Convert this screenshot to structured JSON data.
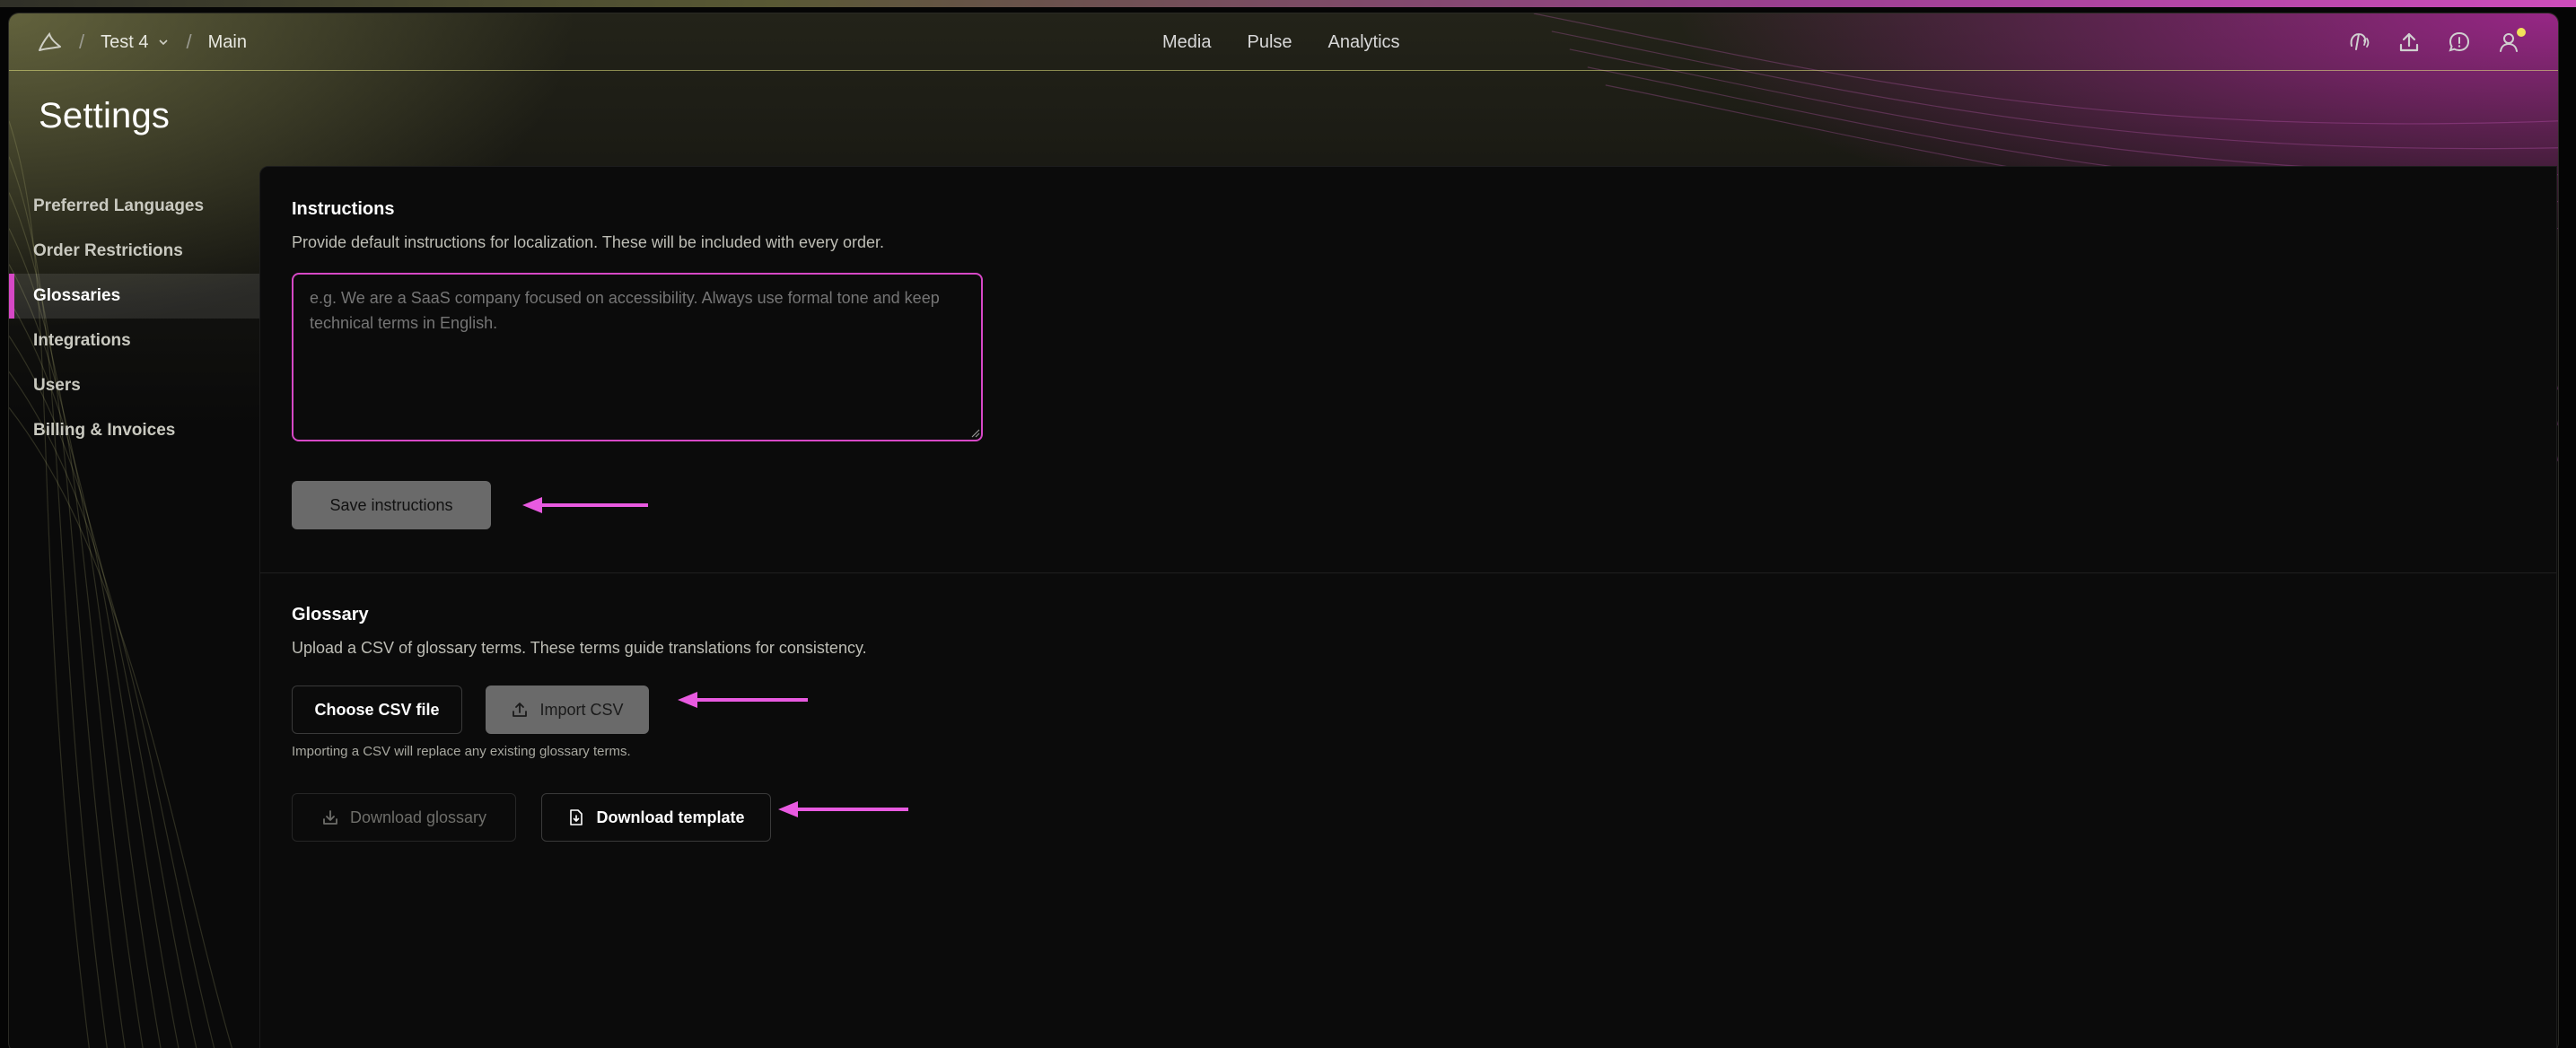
{
  "topbar": {
    "breadcrumb": [
      {
        "label": "Test 4",
        "has_dropdown": true
      },
      {
        "label": "Main",
        "has_dropdown": false
      }
    ],
    "separator": "/",
    "nav": [
      "Media",
      "Pulse",
      "Analytics"
    ],
    "right_icons": [
      "headset-icon",
      "upload-icon",
      "chat-icon",
      "user-icon"
    ]
  },
  "page": {
    "title": "Settings"
  },
  "sidebar": {
    "items": [
      {
        "label": "Preferred Languages",
        "active": false
      },
      {
        "label": "Order Restrictions",
        "active": false
      },
      {
        "label": "Glossaries",
        "active": true
      },
      {
        "label": "Integrations",
        "active": false
      },
      {
        "label": "Users",
        "active": false
      },
      {
        "label": "Billing & Invoices",
        "active": false
      }
    ]
  },
  "instructions": {
    "title": "Instructions",
    "description": "Provide default instructions for localization. These will be included with every order.",
    "placeholder": "e.g. We are a SaaS company focused on accessibility. Always use formal tone and keep technical terms in English.",
    "value": "",
    "save_label": "Save instructions"
  },
  "glossary": {
    "title": "Glossary",
    "description": "Upload a CSV of glossary terms. These terms guide translations for consistency.",
    "choose_label": "Choose CSV file",
    "import_label": "Import CSV",
    "note": "Importing a CSV will replace any existing glossary terms.",
    "download_glossary_label": "Download glossary",
    "download_template_label": "Download template"
  },
  "colors": {
    "accent": "#d648c6",
    "annotation_arrow": "#e85ae0",
    "disabled_button": "#6a6a6a",
    "background": "#0b0b0b"
  }
}
